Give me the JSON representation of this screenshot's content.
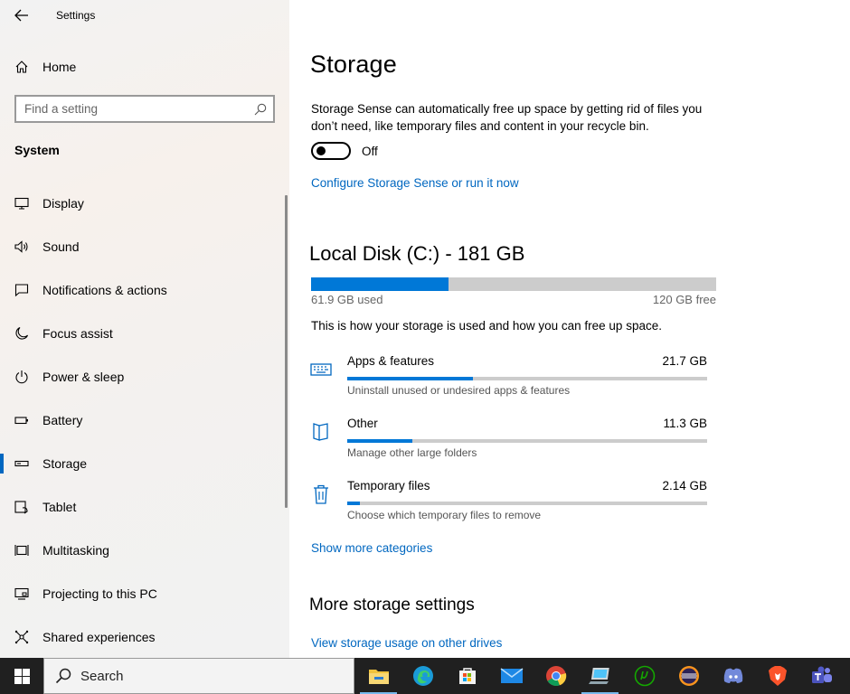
{
  "window": {
    "title": "Settings"
  },
  "sidebar": {
    "home_label": "Home",
    "search_placeholder": "Find a setting",
    "section_title": "System",
    "items": [
      {
        "label": "Display",
        "icon": "display-icon"
      },
      {
        "label": "Sound",
        "icon": "sound-icon"
      },
      {
        "label": "Notifications & actions",
        "icon": "notifications-icon"
      },
      {
        "label": "Focus assist",
        "icon": "moon-icon"
      },
      {
        "label": "Power & sleep",
        "icon": "power-icon"
      },
      {
        "label": "Battery",
        "icon": "battery-icon"
      },
      {
        "label": "Storage",
        "icon": "storage-icon",
        "selected": true
      },
      {
        "label": "Tablet",
        "icon": "tablet-icon"
      },
      {
        "label": "Multitasking",
        "icon": "multitasking-icon"
      },
      {
        "label": "Projecting to this PC",
        "icon": "projecting-icon"
      },
      {
        "label": "Shared experiences",
        "icon": "shared-experiences-icon"
      }
    ]
  },
  "main": {
    "title": "Storage",
    "storage_sense_desc": "Storage Sense can automatically free up space by getting rid of files you don’t need, like temporary files and content in your recycle bin.",
    "toggle_state": "Off",
    "configure_link": "Configure Storage Sense or run it now",
    "disk": {
      "title": "Local Disk (C:) - 181 GB",
      "used_label": "61.9 GB used",
      "free_label": "120 GB free",
      "used_fraction": 0.34
    },
    "usage_desc": "This is how your storage is used and how you can free up space.",
    "categories": [
      {
        "name": "Apps & features",
        "size": "21.7 GB",
        "sub": "Uninstall unused or undesired apps & features",
        "fraction": 0.35,
        "icon": "keyboard-icon"
      },
      {
        "name": "Other",
        "size": "11.3 GB",
        "sub": "Manage other large folders",
        "fraction": 0.18,
        "icon": "other-files-icon"
      },
      {
        "name": "Temporary files",
        "size": "2.14 GB",
        "sub": "Choose which temporary files to remove",
        "fraction": 0.035,
        "icon": "trash-icon"
      }
    ],
    "show_more_link": "Show more categories",
    "more_settings_title": "More storage settings",
    "view_usage_link": "View storage usage on other drives"
  },
  "taskbar": {
    "search_label": "Search",
    "apps": [
      "file-explorer-icon",
      "edge-icon",
      "store-icon",
      "mail-icon",
      "chrome-icon",
      "settings-app-icon",
      "upwork-icon",
      "eclipse-icon",
      "discord-icon",
      "brave-icon",
      "teams-icon"
    ]
  },
  "colors": {
    "accent": "#0078d7",
    "link": "#0067c0",
    "taskbar": "#202020"
  }
}
